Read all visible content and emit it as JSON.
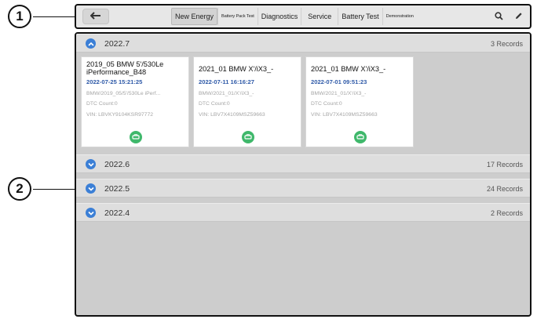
{
  "callouts": {
    "one": "1",
    "two": "2"
  },
  "toolbar": {
    "tabs": [
      {
        "label": "New Energy",
        "active": true
      },
      {
        "label": "Battery Pack Test"
      },
      {
        "label": "Diagnostics"
      },
      {
        "label": "Service"
      },
      {
        "label": "Battery Test"
      },
      {
        "label": "Demonstration"
      }
    ],
    "icons": [
      "back-arrow-icon",
      "search-icon",
      "pencil-icon"
    ]
  },
  "groups": [
    {
      "year": "2022.7",
      "count": "3 Records",
      "expanded": true,
      "cards": [
        {
          "title": "2019_05 BMW 5'/530Le iPerformance_B48",
          "date": "2022-07-25 15:21:25",
          "path": "BMW/2019_05/5'/530Le iPerf...",
          "dtc": "DTC Count:0",
          "vin": "VIN: LBVKY9104KSR97772"
        },
        {
          "title": "2021_01 BMW X'/iX3_-",
          "date": "2022-07-11 16:16:27",
          "path": "BMW/2021_01/X'/iX3_-",
          "dtc": "DTC Count:0",
          "vin": "VIN: LBV7X4109MSZ59663"
        },
        {
          "title": "2021_01 BMW X'/iX3_-",
          "date": "2022-07-01 09:51:23",
          "path": "BMW/2021_01/X'/iX3_-",
          "dtc": "DTC Count:0",
          "vin": "VIN: LBV7X4109MSZ59663"
        }
      ]
    },
    {
      "year": "2022.6",
      "count": "17 Records",
      "expanded": false
    },
    {
      "year": "2022.5",
      "count": "24 Records",
      "expanded": false
    },
    {
      "year": "2022.4",
      "count": "2 Records",
      "expanded": false
    }
  ],
  "colors": {
    "accent": "#3b7fd6",
    "report_icon": "#3fb86b",
    "date_text": "#2f5aa8"
  }
}
